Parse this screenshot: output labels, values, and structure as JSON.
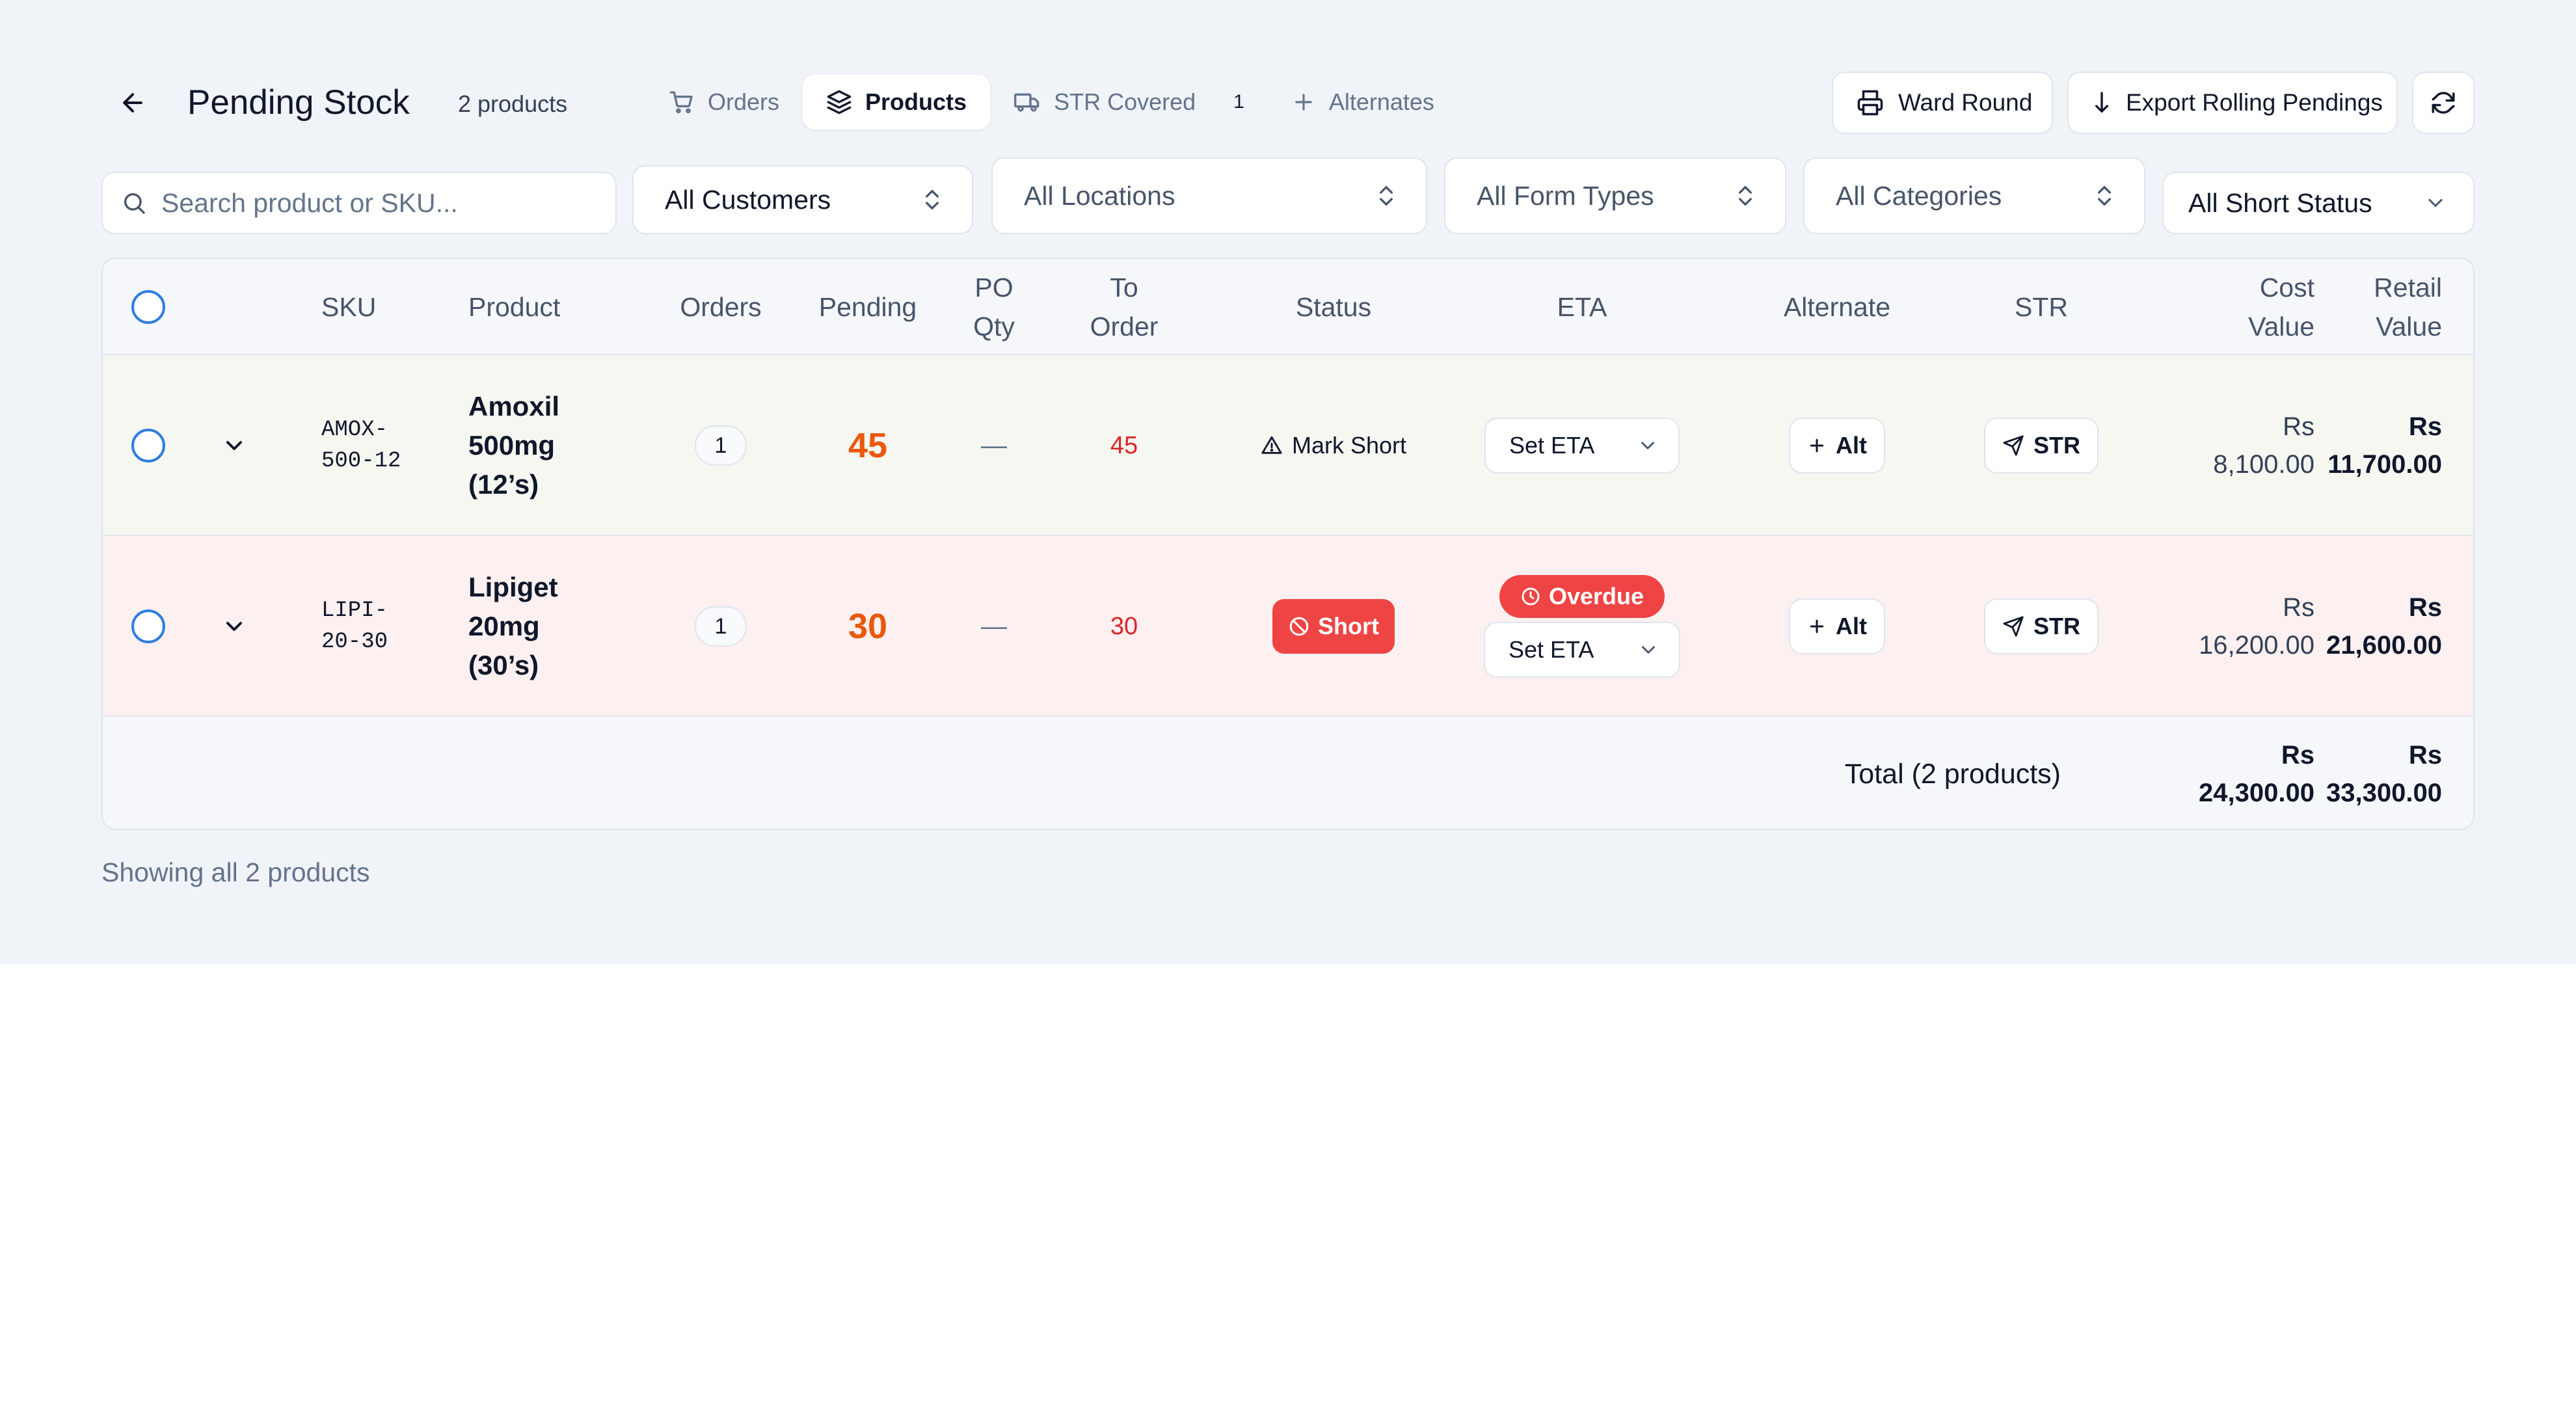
{
  "header": {
    "title": "Pending Stock",
    "product_count": "2 products",
    "tabs": [
      {
        "label": "Orders",
        "icon": "cart-icon",
        "active": false
      },
      {
        "label": "Products",
        "icon": "layers-icon",
        "active": true
      },
      {
        "label": "STR Covered",
        "icon": "truck-icon",
        "badge": "1",
        "active": false
      },
      {
        "label": "Alternates",
        "icon": "plus-icon",
        "active": false
      }
    ],
    "ward_round_label": "Ward Round",
    "export_label": "Export Rolling Pendings"
  },
  "filters": {
    "search_placeholder": "Search product or SKU...",
    "customers": "All Customers",
    "locations": "All Locations",
    "form_types": "All Form Types",
    "categories": "All Categories",
    "short_status": "All Short Status"
  },
  "table": {
    "columns": {
      "sku": "SKU",
      "product": "Product",
      "orders": "Orders",
      "pending": "Pending",
      "po_qty": "PO\nQty",
      "to_order": "To\nOrder",
      "status": "Status",
      "eta": "ETA",
      "alternate": "Alternate",
      "str": "STR",
      "cost_value": "Cost\nValue",
      "retail_value": "Retail\nValue"
    },
    "rows": [
      {
        "sku": "AMOX-\n500-12",
        "product": "Amoxil\n500mg\n(12’s)",
        "orders": "1",
        "pending": "45",
        "po_qty": "—",
        "to_order": "45",
        "status_label": "Mark Short",
        "eta_label": "Set ETA",
        "alt_label": "Alt",
        "str_label": "STR",
        "cost_currency": "Rs",
        "cost_value": "8,100.00",
        "retail_currency": "Rs",
        "retail_value": "11,700.00"
      },
      {
        "sku": "LIPI-\n20-30",
        "product": "Lipiget\n20mg\n(30’s)",
        "orders": "1",
        "pending": "30",
        "po_qty": "—",
        "to_order": "30",
        "status_label": "Short",
        "overdue_label": "Overdue",
        "eta_label": "Set ETA",
        "alt_label": "Alt",
        "str_label": "STR",
        "cost_currency": "Rs",
        "cost_value": "16,200.00",
        "retail_currency": "Rs",
        "retail_value": "21,600.00"
      }
    ],
    "footer": {
      "total_label": "Total (2 products)",
      "cost_currency": "Rs",
      "cost_total": "24,300.00",
      "retail_currency": "Rs",
      "retail_total": "33,300.00"
    }
  },
  "showing_text": "Showing all 2 products",
  "colors": {
    "background": "#f0f3f8",
    "accent_blue": "#2f7ee0",
    "pending_orange": "#ea580c",
    "danger_red": "#ef4444",
    "short_row_bg": "#fdf0f0",
    "normal_row_bg": "#f6f7f1"
  }
}
